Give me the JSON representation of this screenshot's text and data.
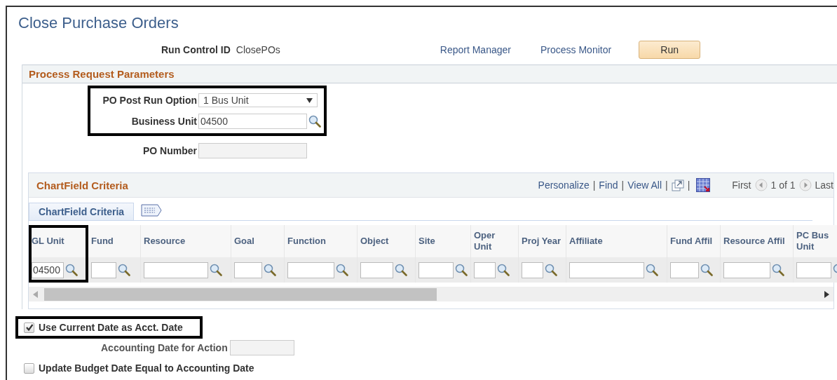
{
  "page": {
    "title": "Close Purchase Orders"
  },
  "run_control": {
    "label": "Run Control ID",
    "value": "ClosePOs",
    "links": [
      "Report Manager",
      "Process Monitor"
    ],
    "button": "Run"
  },
  "parameters": {
    "title": "Process Request Parameters",
    "groups": [
      {
        "highlighted": true,
        "fields": [
          {
            "kind": "dropdown",
            "label": "PO Post Run Option",
            "value": "1 Bus Unit"
          },
          {
            "kind": "lookup",
            "label": "Business Unit",
            "value": "04500"
          }
        ]
      },
      {
        "highlighted": false,
        "fields": [
          {
            "kind": "text",
            "label": "PO Number",
            "disabled": true
          }
        ]
      }
    ]
  },
  "chartfield": {
    "title": "ChartField Criteria",
    "toolbar": [
      {
        "kind": "link",
        "text": "Personalize"
      },
      {
        "kind": "sep",
        "text": "|"
      },
      {
        "kind": "link",
        "text": "Find"
      },
      {
        "kind": "sep",
        "text": "|"
      },
      {
        "kind": "link",
        "text": "View All"
      },
      {
        "kind": "sep",
        "text": "|"
      },
      {
        "kind": "zoom-icon"
      },
      {
        "kind": "sep",
        "text": "|"
      },
      {
        "kind": "grid-icon"
      },
      {
        "kind": "plain",
        "text": "First"
      },
      {
        "kind": "prev"
      },
      {
        "kind": "plain",
        "text": "1 of 1"
      },
      {
        "kind": "next"
      },
      {
        "kind": "plain",
        "text": "Last"
      }
    ],
    "tabs": [
      {
        "kind": "text",
        "label": "ChartField Criteria",
        "selected": true
      },
      {
        "kind": "icon",
        "selected": false
      }
    ],
    "columns": [
      {
        "label": "GL Unit",
        "value": "04500",
        "highlighted": true
      },
      {
        "label": "Fund",
        "highlighted": false
      },
      {
        "label": "Resource",
        "highlighted": false
      },
      {
        "label": "Goal",
        "highlighted": false
      },
      {
        "label": "Function",
        "highlighted": false
      },
      {
        "label": "Object",
        "highlighted": false
      },
      {
        "label": "Site",
        "highlighted": false
      },
      {
        "label": "Oper Unit",
        "highlighted": false
      },
      {
        "label": "Proj Year",
        "highlighted": false
      },
      {
        "label": "Affiliate",
        "highlighted": false
      },
      {
        "label": "Fund Affil",
        "highlighted": false
      },
      {
        "label": "Resource Affil",
        "highlighted": false
      },
      {
        "label": "PC Bus Unit",
        "highlighted": false
      }
    ]
  },
  "options": [
    {
      "kind": "checkbox",
      "label": "Use Current Date as Acct. Date",
      "checked": true,
      "highlighted": true
    },
    {
      "kind": "field",
      "label": "Accounting Date for Action",
      "disabled": true
    },
    {
      "kind": "checkbox",
      "label": "Update Budget Date Equal to Accounting Date",
      "checked": false,
      "highlighted": false
    }
  ]
}
